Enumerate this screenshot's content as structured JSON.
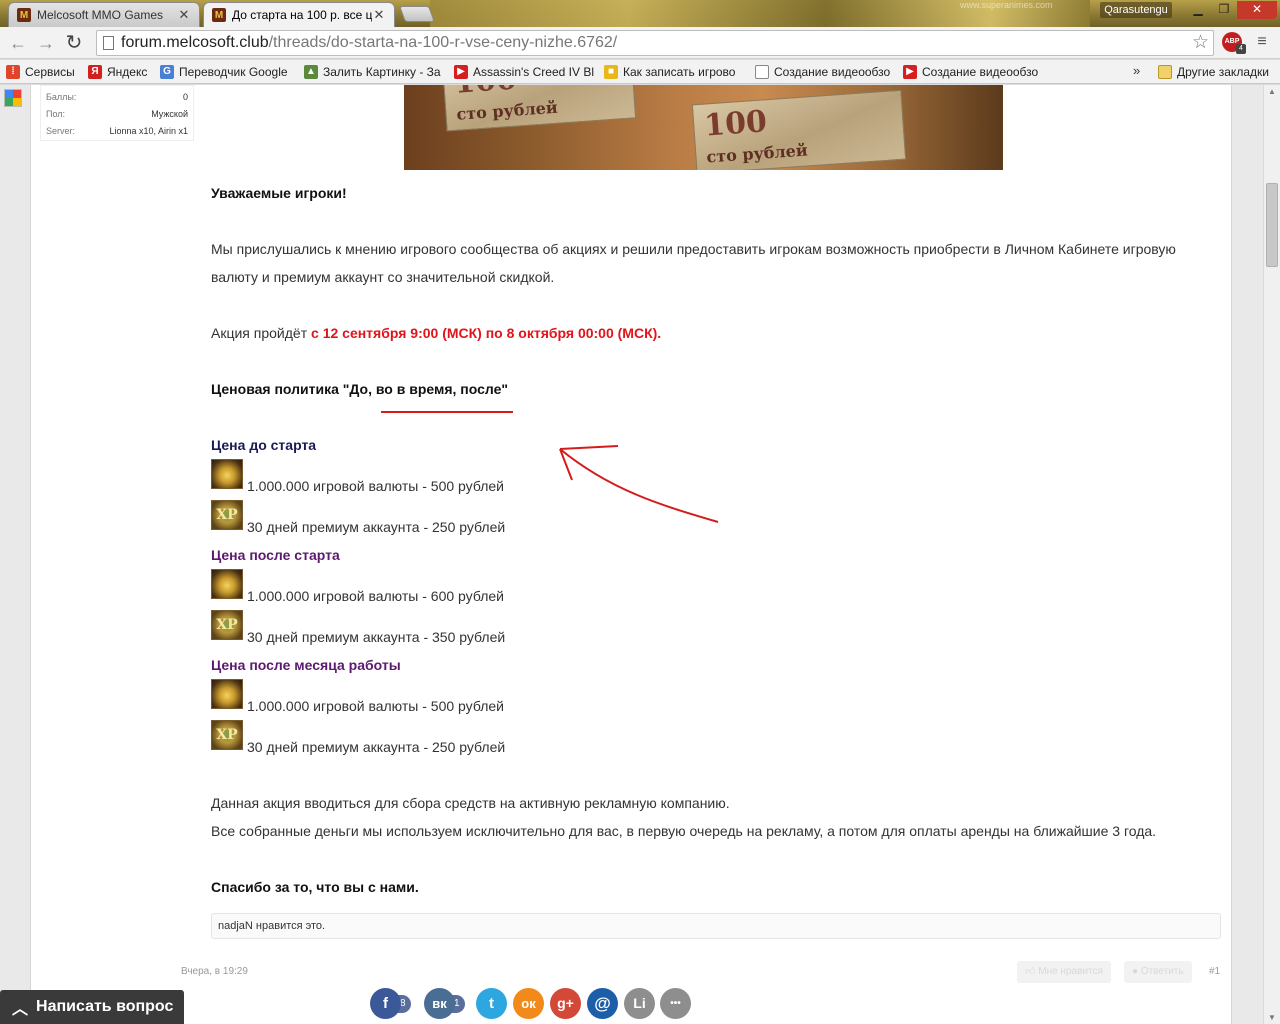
{
  "tabs": [
    {
      "title": "Melcosoft MMO Games",
      "favicon": "M"
    },
    {
      "title": "До старта на 100 р. все ц",
      "favicon": "M"
    }
  ],
  "window": {
    "user": "Qarasutengu",
    "watermark": "www.superanimes.com"
  },
  "address": {
    "host": "forum.melcosoft.club",
    "path": "/threads/do-starta-na-100-r-vse-ceny-nizhe.6762/"
  },
  "extensions": {
    "abp_label": "ABP",
    "abp_count": "4"
  },
  "bookmarks": [
    {
      "label": "Сервисы",
      "icon": "apps-icon",
      "color": "#e0452c"
    },
    {
      "label": "Яндекс",
      "icon": "yandex-icon",
      "color": "#d12020"
    },
    {
      "label": "Переводчик Google",
      "icon": "translate-icon",
      "color": "#4a7fd6"
    },
    {
      "label": "Залить Картинку - За",
      "icon": "image-upload-icon",
      "color": "#5a8a3a"
    },
    {
      "label": "Assassin's Creed IV Bl",
      "icon": "youtube-icon",
      "color": "#d42020"
    },
    {
      "label": "Как записать игрово",
      "icon": "bookmark-yellow-icon",
      "color": "#e8b81a"
    },
    {
      "label": "Создание видеообзо",
      "icon": "page-icon",
      "color": "#888888"
    },
    {
      "label": "Создание видеообзо",
      "icon": "youtube-icon",
      "color": "#d42020"
    }
  ],
  "bookmarks_more": "»",
  "other_bookmarks": "Другие закладки",
  "user_info": [
    {
      "k": "Баллы:",
      "v": "0"
    },
    {
      "k": "Пол:",
      "v": "Мужской"
    },
    {
      "k": "Server:",
      "v": "Lionna x10, Airin x1"
    }
  ],
  "banner": {
    "notes": [
      {
        "denom": "100",
        "words": "сто рублей"
      },
      {
        "denom": "100",
        "words": "сто рублей"
      }
    ]
  },
  "post": {
    "greeting": "Уважаемые игроки!",
    "intro_line1": "Мы прислушались к мнению игрового сообщества об акциях и решили предоставить игрокам возможность приобрести в Личном Кабинете игровую",
    "intro_line2": "валюту и премиум аккаунт со значительной скидкой.",
    "promo_prefix": "Акция пройдёт ",
    "promo_dates": "с 12 сентября 9:00 (МСК) по 8 октября 00:00 (МСК).",
    "policy_title": "Ценовая политика \"До, во в время, после\"",
    "sections": [
      {
        "title": "Цена до старта",
        "items": [
          "1.000.000 игровой валюты - 500 рублей",
          "30 дней премиум аккаунта - 250 рублей"
        ]
      },
      {
        "title": "Цена после старта",
        "items": [
          "1.000.000 игровой валюты - 600 рублей",
          "30 дней премиум аккаунта - 350 рублей"
        ]
      },
      {
        "title": "Цена после месяца работы",
        "items": [
          "1.000.000 игровой валюты - 500 рублей",
          "30 дней премиум аккаунта - 250 рублей"
        ]
      }
    ],
    "purpose_line1": "Данная акция вводиться для сбора средств на активную рекламную компанию.",
    "purpose_line2": "Все собранные деньги мы используем исключительно для вас, в первую очередь на рекламу, а потом для оплаты аренды на ближайшие 3 года.",
    "thanks": "Спасибо за то, что вы с нами.",
    "likes": "nadjaN нравится это.",
    "date": "Вчера, в 19:29",
    "like_button": "Мне нравится",
    "reply_button": "Ответить",
    "post_number": "#1"
  },
  "ask_button": "Написать вопрос",
  "social": [
    {
      "name": "facebook-icon",
      "glyph": "f",
      "color": "#3b5998",
      "count": "8"
    },
    {
      "name": "vkontakte-icon",
      "glyph": "вк",
      "color": "#4a6d93",
      "count": "1"
    },
    {
      "name": "twitter-icon",
      "glyph": "t",
      "color": "#2ca7e0",
      "count": ""
    },
    {
      "name": "odnoklassniki-icon",
      "glyph": "ок",
      "color": "#f28a1b",
      "count": ""
    },
    {
      "name": "googleplus-icon",
      "glyph": "g+",
      "color": "#d34836",
      "count": ""
    },
    {
      "name": "mailru-icon",
      "glyph": "@",
      "color": "#1c5ea8",
      "count": ""
    },
    {
      "name": "liveinternet-icon",
      "glyph": "Li",
      "color": "#8e8e8e",
      "count": ""
    },
    {
      "name": "more-icon",
      "glyph": "•••",
      "color": "#8e8e8e",
      "count": ""
    }
  ],
  "colors": {
    "promo_red": "#e0141a",
    "heading_blue": "#1a1a55",
    "heading_purple": "#5a1a6e",
    "annotation_red": "#d41c1c"
  }
}
